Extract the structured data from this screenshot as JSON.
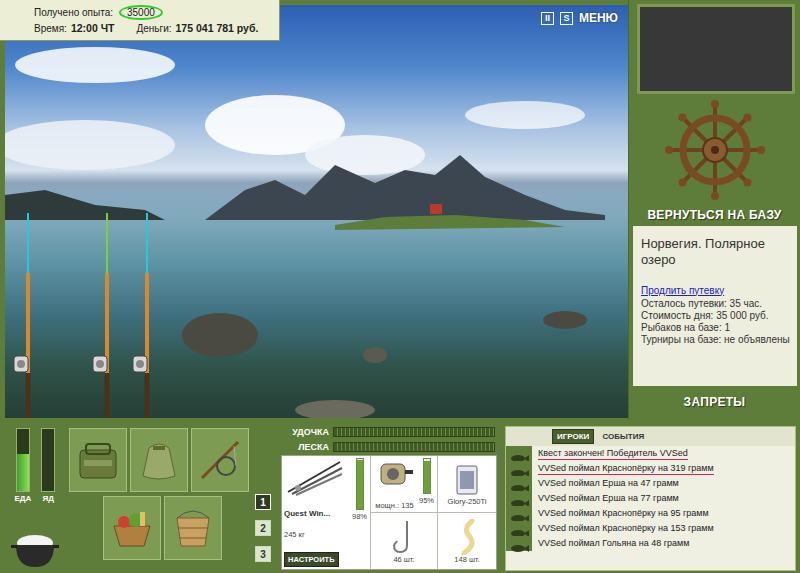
{
  "hud": {
    "exp_label": "Получено опыта:",
    "exp_value": "35000",
    "exp_circled": true,
    "time_label": "Время:",
    "time": "12:00 ЧТ",
    "money_label": "Деньги:",
    "money": "175 041 781 руб."
  },
  "controls": [
    {
      "label": "II",
      "kind": "icon"
    },
    {
      "label": "S",
      "kind": "icon"
    },
    {
      "label": "МЕНЮ",
      "kind": "text"
    }
  ],
  "rods": [
    {
      "color": "#2fc4d6"
    },
    {
      "color": "#7fcf3a"
    },
    {
      "color": "#2fc4d6"
    }
  ],
  "side": {
    "return_button": "ВЕРНУТЬСЯ НА БАЗУ",
    "location": "Норвегия. Полярное озеро",
    "extend_link": "Продлить путевку",
    "info": [
      "Осталось путевки: 35 час.",
      "Стоимость дня: 35 000 руб.",
      "Рыбаков на базе: 1",
      "Турниры на базе: не объявлены"
    ],
    "bans_button": "ЗАПРЕТЫ"
  },
  "needs": [
    {
      "label": "ЕДА",
      "level": 0.6
    },
    {
      "label": "ЯД",
      "level": 0
    }
  ],
  "pages": [
    {
      "label": "1",
      "selected": true
    },
    {
      "label": "2",
      "selected": false
    },
    {
      "label": "3",
      "selected": false
    }
  ],
  "tackle": {
    "rod_bar": {
      "label": "УДОЧКА",
      "level": 0
    },
    "line_bar": {
      "label": "ЛЕСКА",
      "level": 0
    },
    "rod": {
      "name": "Quest Win...",
      "load": "245 кг",
      "wear": "98%",
      "level": 0.98,
      "button": "НАСТРОИТЬ"
    },
    "reel": {
      "power": "мощн.: 135",
      "wear": "95%",
      "level": 0.95
    },
    "line": {
      "name": "Glory-250Ti"
    },
    "hook": {
      "count": "46 шт."
    },
    "bait": {
      "count": "148 шт."
    }
  },
  "chat": {
    "tabs": [
      {
        "label": "ИГРОКИ",
        "selected": true
      },
      {
        "label": "СОБЫТИЯ",
        "selected": false
      }
    ],
    "messages": [
      {
        "text": "Квест закончен! Победитель VVSed",
        "highlighted": true
      },
      {
        "text": "VVSed поймал Краснопёрку на 319 грамм",
        "highlighted": true
      },
      {
        "text": "VVSed поймал Ерша на 47 грамм",
        "highlighted": false
      },
      {
        "text": "VVSed поймал Ерша на 77 грамм",
        "highlighted": false
      },
      {
        "text": "VVSed поймал Краснопёрку на 95 грамм",
        "highlighted": false
      },
      {
        "text": "VVSed поймал Краснопёрку на 153 грамм",
        "highlighted": false
      },
      {
        "text": "VVSed поймал Гольяна на 48 грамм",
        "highlighted": false
      }
    ]
  }
}
